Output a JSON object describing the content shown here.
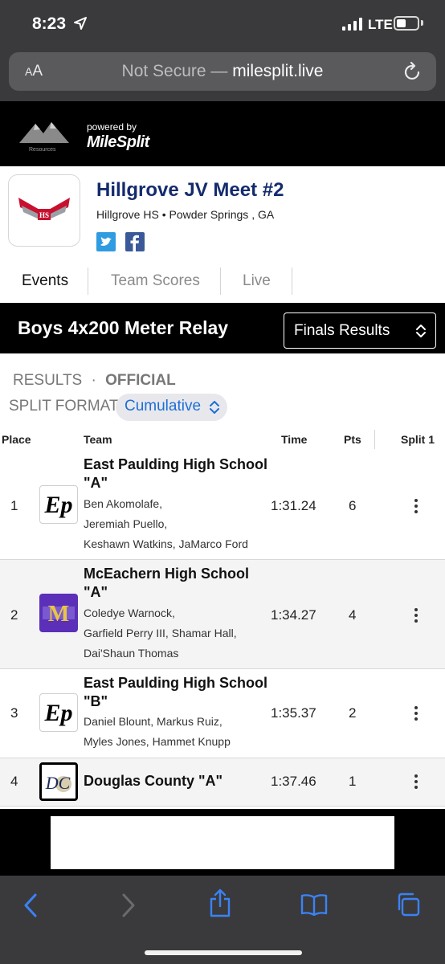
{
  "status_bar": {
    "time": "8:23",
    "network": "LTE"
  },
  "browser": {
    "aa_label": "AA",
    "url_prefix": "Not Secure — ",
    "url_domain": "milesplit.live"
  },
  "site": {
    "brand_small": "powered by",
    "brand_name": "MileSplit",
    "sponsor_small": "Olympia Resources"
  },
  "meet": {
    "title": "Hillgrove JV Meet #2",
    "location": "Hillgrove HS • Powder Springs , GA",
    "logo_text": "HS"
  },
  "tabs": [
    {
      "label": "Events",
      "active": true
    },
    {
      "label": "Team Scores",
      "active": false
    },
    {
      "label": "Live",
      "active": false
    }
  ],
  "event": {
    "title": "Boys 4x200 Meter Relay",
    "round_select": "Finals Results"
  },
  "results": {
    "status_label": "RESULTS",
    "status_sep": "·",
    "status_value": "OFFICIAL",
    "split_format_label": "SPLIT FORMAT:",
    "split_format_value": "Cumulative"
  },
  "table": {
    "headers": {
      "place": "Place",
      "team": "Team",
      "time": "Time",
      "pts": "Pts",
      "split": "Split 1"
    },
    "rows": [
      {
        "place": "1",
        "team": "East Paulding High School \"A\"",
        "athletes": [
          "Ben Akomolafe,",
          "Jeremiah Puello,",
          "Keshawn Watkins,  JaMarco Ford"
        ],
        "time": "1:31.24",
        "pts": "6",
        "logo_text": "Ep"
      },
      {
        "place": "2",
        "team": "McEachern High School \"A\"",
        "athletes": [
          "Coledye Warnock,",
          "Garfield Perry III,  Shamar Hall,",
          "Dai'Shaun Thomas"
        ],
        "time": "1:34.27",
        "pts": "4",
        "logo_text": "M"
      },
      {
        "place": "3",
        "team": "East Paulding High School \"B\"",
        "athletes": [
          "Daniel Blount,  Markus Ruiz,",
          "Myles Jones,  Hammet Knupp"
        ],
        "time": "1:35.37",
        "pts": "2",
        "logo_text": "Ep"
      },
      {
        "place": "4",
        "team": "Douglas County \"A\"",
        "athletes": [],
        "time": "1:37.46",
        "pts": "1",
        "logo_text": "DC"
      }
    ]
  },
  "colors": {
    "meet_title": "#152b6e",
    "link_blue": "#1d6fd8",
    "mceachern_purple": "#5b2fb8",
    "twitter": "#2f9be0",
    "facebook": "#3b5998",
    "chrome_dark": "#3a3a3c"
  }
}
